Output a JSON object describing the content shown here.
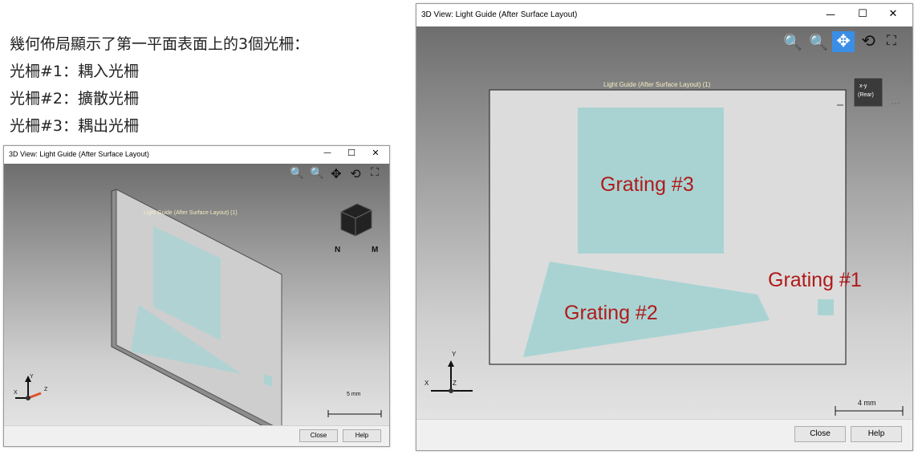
{
  "caption": {
    "line1": "幾何佈局顯示了第一平面表面上的3個光柵：",
    "line2": "光柵#1：耦入光柵",
    "line3": "光柵#2：擴散光柵",
    "line4": "光柵#3：耦出光柵"
  },
  "left_window": {
    "title": "3D View: Light Guide (After Surface Layout)",
    "minimize": "—",
    "maximize": "☐",
    "close": "✕",
    "scene_label": "Light Guide (After Surface Layout) (1)",
    "scale_label": "5 mm",
    "buttons": {
      "close": "Close",
      "help": "Help"
    },
    "axes": {
      "x": "X",
      "y": "Y",
      "z": "Z"
    },
    "tools": {
      "zoom_window": "🔍",
      "zoom": "🔍",
      "pan": "✥",
      "rotate": "⟲",
      "fit": "⛶"
    }
  },
  "right_window": {
    "title": "3D View: Light Guide (After Surface Layout)",
    "minimize": "—",
    "maximize": "☐",
    "close": "✕",
    "scene_label": "Light Guide (After Surface Layout) (1)",
    "cube_label_1": "x-y",
    "cube_label_2": "(Rear)",
    "scale_label": "4 mm",
    "buttons": {
      "close": "Close",
      "help": "Help"
    },
    "axes": {
      "x": "X",
      "y": "Y",
      "z": "Z"
    },
    "tools": {
      "zoom_window": "🔍",
      "zoom": "🔍",
      "pan": "✥",
      "rotate": "⟲",
      "fit": "⛶"
    },
    "gratings": {
      "g1": "Grating #1",
      "g2": "Grating #2",
      "g3": "Grating #3"
    }
  },
  "colors": {
    "grating_fill": "#a9d3d3",
    "grating_label": "#b01a1a",
    "pan_active": "#3a8ee6"
  }
}
